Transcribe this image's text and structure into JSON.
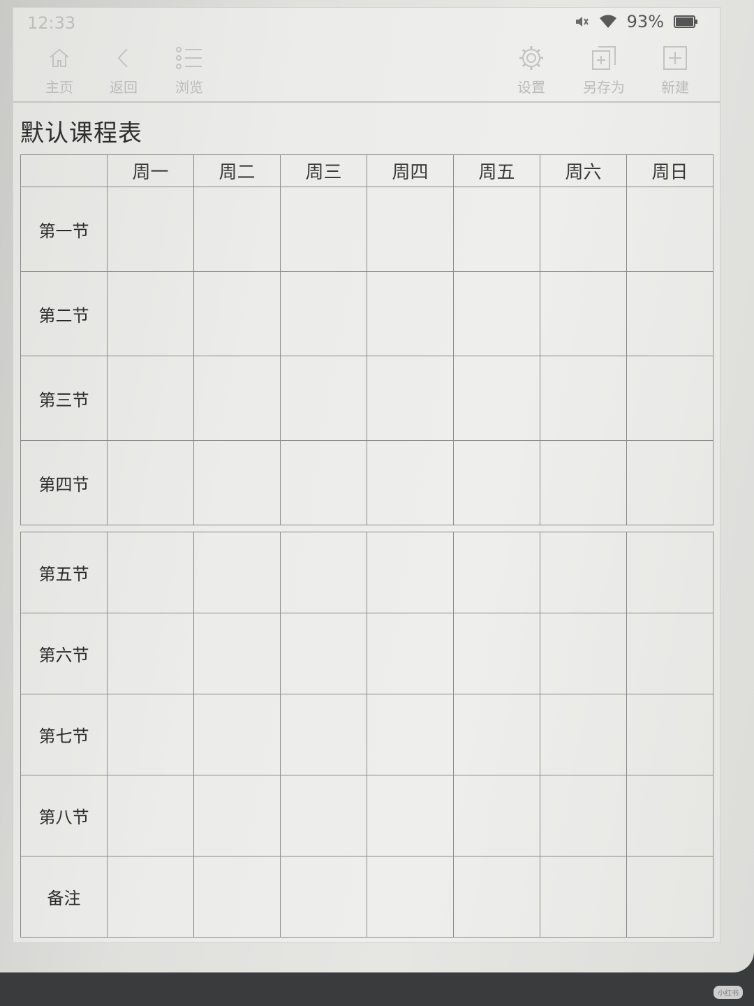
{
  "status": {
    "time": "12:33",
    "battery": "93%"
  },
  "toolbar": {
    "home": "主页",
    "back": "返回",
    "browse": "浏览",
    "settings": "设置",
    "save_as": "另存为",
    "new": "新建"
  },
  "page": {
    "title": "默认课程表"
  },
  "timetable": {
    "days": [
      "周一",
      "周二",
      "周三",
      "周四",
      "周五",
      "周六",
      "周日"
    ],
    "periods": [
      "第一节",
      "第二节",
      "第三节",
      "第四节",
      "第五节",
      "第六节",
      "第七节",
      "第八节",
      "备注"
    ]
  },
  "watermark": "小红书"
}
